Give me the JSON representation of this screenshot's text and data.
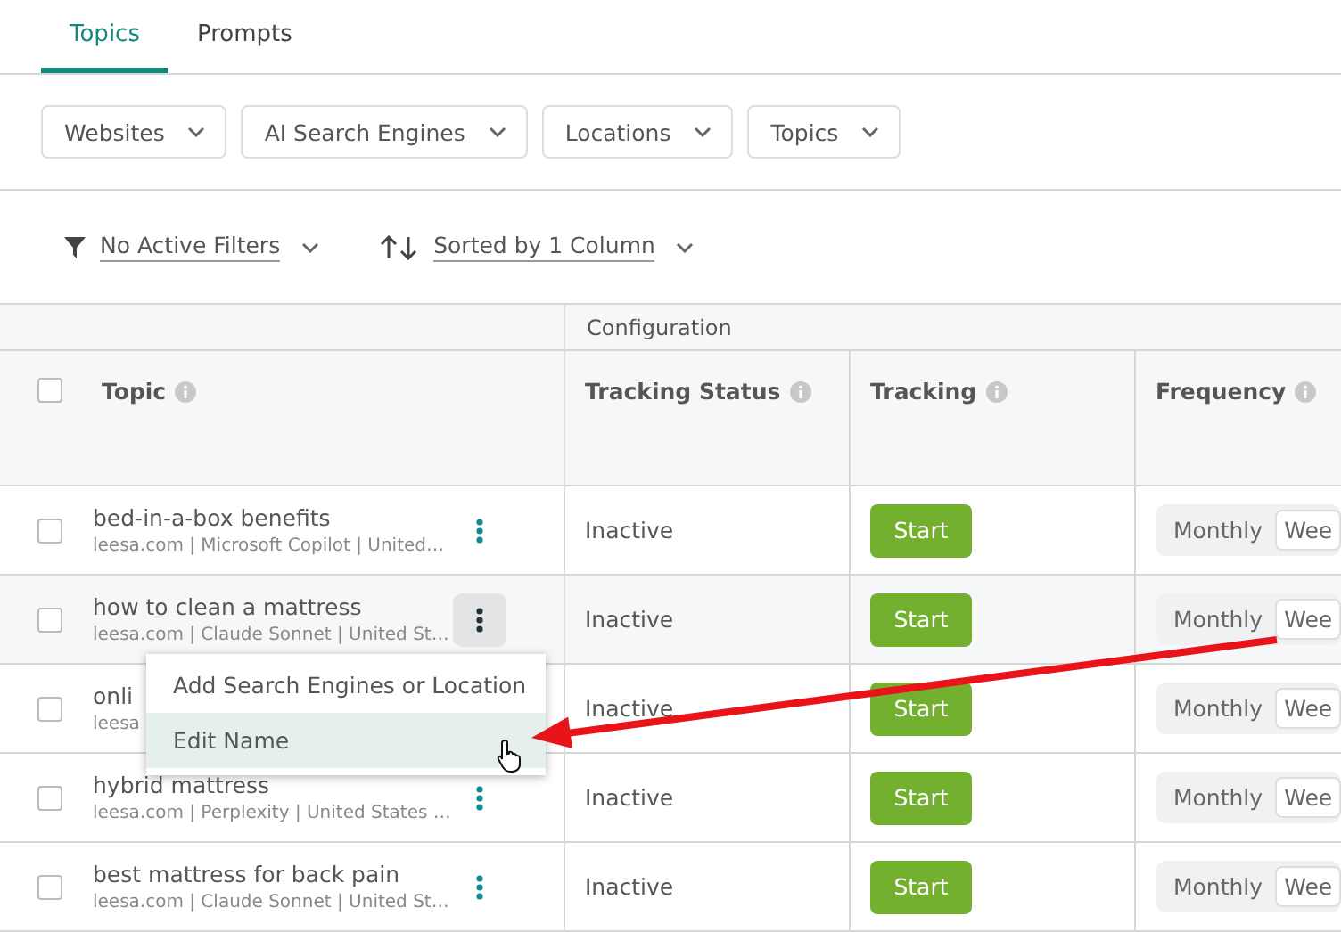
{
  "tabs": [
    {
      "label": "Topics",
      "selected": true
    },
    {
      "label": "Prompts",
      "selected": false
    }
  ],
  "filters": [
    "Websites",
    "AI Search Engines",
    "Locations",
    "Topics"
  ],
  "toolbar": {
    "filter_label": "No Active Filters",
    "sort_label": "Sorted by 1 Column"
  },
  "table": {
    "group_header": "Configuration",
    "select_all_checked": false,
    "columns": [
      {
        "label": "Topic"
      },
      {
        "label": "Tracking Status"
      },
      {
        "label": "Tracking"
      },
      {
        "label": "Frequency"
      }
    ],
    "rows": [
      {
        "topic": "bed-in-a-box benefits",
        "details": "leesa.com | Microsoft Copilot | United…",
        "status": "Inactive",
        "action": "Start",
        "menu_open": false,
        "checked": false,
        "frequency": [
          {
            "label": "Monthly",
            "selected": false
          },
          {
            "label": "Wee",
            "selected": true
          }
        ]
      },
      {
        "topic": "how to clean a mattress",
        "details": "leesa.com | Claude Sonnet | United St…",
        "status": "Inactive",
        "action": "Start",
        "menu_open": true,
        "checked": false,
        "frequency": [
          {
            "label": "Monthly",
            "selected": false
          },
          {
            "label": "Wee",
            "selected": true
          }
        ]
      },
      {
        "topic": "onli",
        "details": "leesa",
        "status": "Inactive",
        "action": "Start",
        "menu_open": false,
        "checked": false,
        "frequency": [
          {
            "label": "Monthly",
            "selected": false
          },
          {
            "label": "Wee",
            "selected": true
          }
        ]
      },
      {
        "topic": "hybrid mattress",
        "details": "leesa.com | Perplexity | United States …",
        "status": "Inactive",
        "action": "Start",
        "menu_open": false,
        "checked": false,
        "frequency": [
          {
            "label": "Monthly",
            "selected": false
          },
          {
            "label": "Wee",
            "selected": true
          }
        ]
      },
      {
        "topic": "best mattress for back pain",
        "details": "leesa.com | Claude Sonnet | United St…",
        "status": "Inactive",
        "action": "Start",
        "menu_open": false,
        "checked": false,
        "frequency": [
          {
            "label": "Monthly",
            "selected": false
          },
          {
            "label": "Wee",
            "selected": true
          }
        ]
      }
    ]
  },
  "row_menu": {
    "items": [
      {
        "label": "Add Search Engines or Location",
        "selected": false
      },
      {
        "label": "Edit Name",
        "selected": true
      }
    ]
  }
}
